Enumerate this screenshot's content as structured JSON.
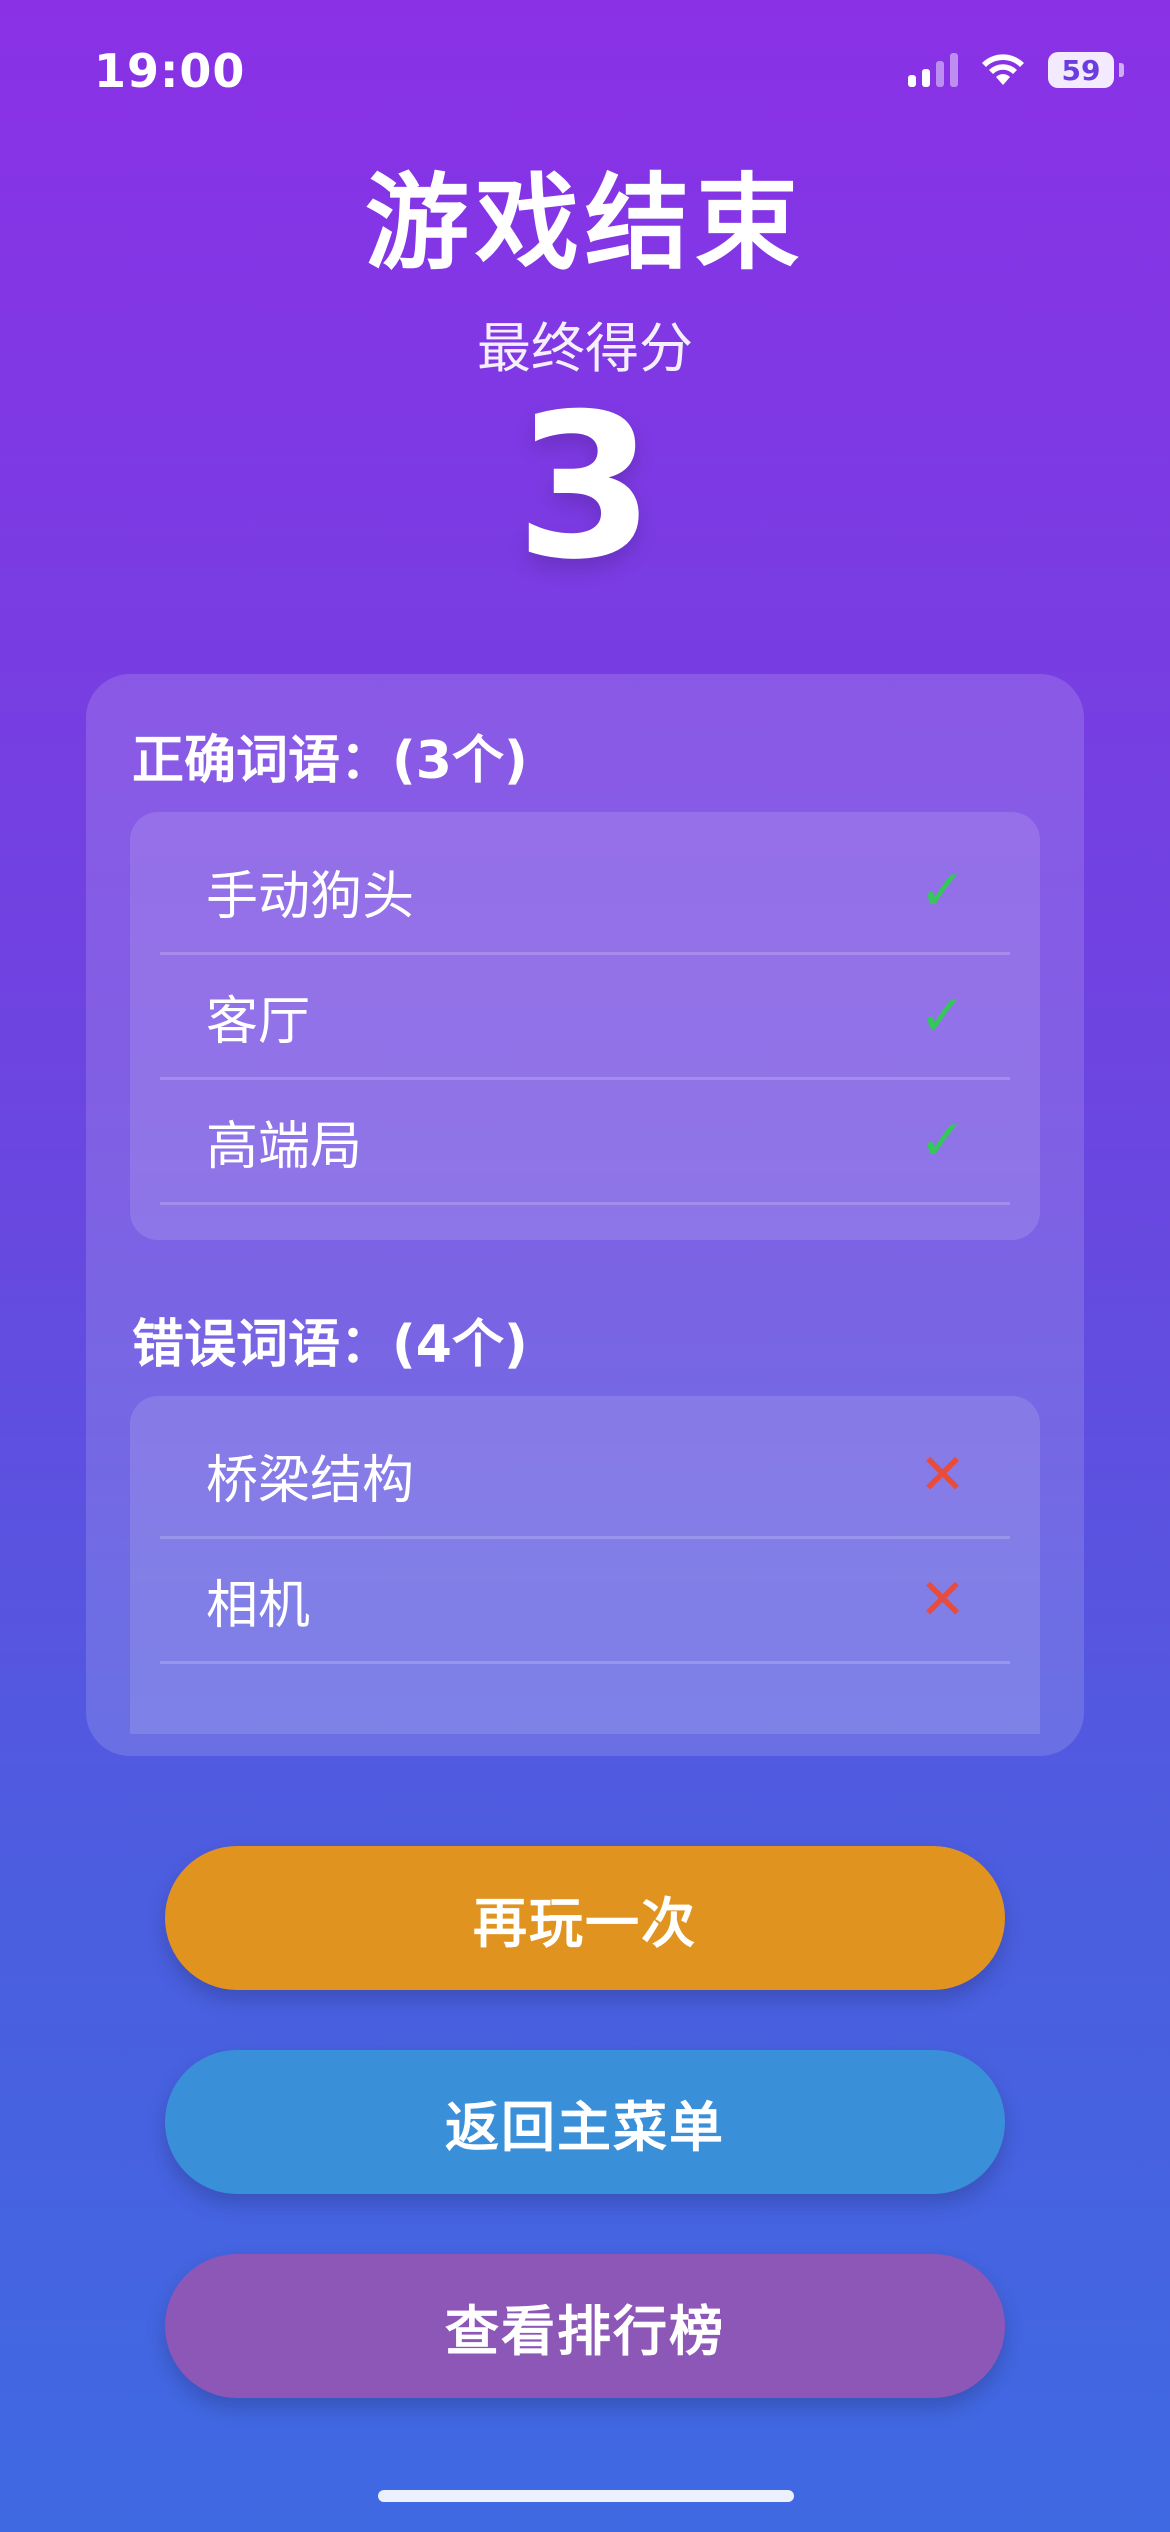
{
  "status_bar": {
    "time": "19:00",
    "battery": "59"
  },
  "header": {
    "title": "游戏结束",
    "subtitle": "最终得分",
    "score": "3"
  },
  "results": {
    "correct": {
      "title": "正确词语：(3个)",
      "items": [
        {
          "word": "手动狗头",
          "status": "correct"
        },
        {
          "word": "客厅",
          "status": "correct"
        },
        {
          "word": "高端局",
          "status": "correct"
        }
      ]
    },
    "wrong": {
      "title": "错误词语：(4个)",
      "items": [
        {
          "word": "桥梁结构",
          "status": "wrong"
        },
        {
          "word": "相机",
          "status": "wrong"
        }
      ]
    }
  },
  "actions": {
    "play_again": "再玩一次",
    "main_menu": "返回主菜单",
    "leaderboard": "查看排行榜"
  },
  "colors": {
    "gradient_top": "#8a31e6",
    "gradient_bottom": "#3f69e2",
    "check": "#34c759",
    "cross": "#e74c3c",
    "play_again": "#e0941f",
    "main_menu": "#3a8fd9",
    "leaderboard": "#8d57b8"
  },
  "icons": {
    "correct": "check-icon",
    "wrong": "cross-icon"
  }
}
